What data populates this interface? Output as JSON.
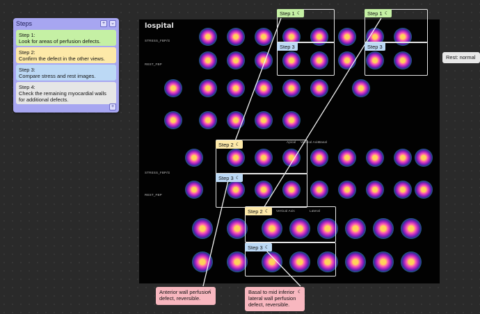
{
  "panel": {
    "title": "Steps",
    "add": "+",
    "collapse": "⌄",
    "steps": [
      {
        "label": "Step 1:",
        "text": "Look for areas of perfusion defects."
      },
      {
        "label": "Step 2:",
        "text": "Confirm the defect in the other views."
      },
      {
        "label": "Step 3:",
        "text": "Compare stress and rest images."
      },
      {
        "label": "Step 4:",
        "text": "Check the remaining myocardial walls for additional defects."
      }
    ],
    "footer_add": "+"
  },
  "viewer": {
    "brand": "lospital",
    "row_labels": [
      "STRESS_FBP/G",
      "REST_FBP",
      "STRESS_FBP/G",
      "REST_FBP"
    ],
    "mid_labels": [
      "Apical",
      "Vertical Axis",
      "Basal"
    ],
    "mid_labels2": [
      "Vertical Axis",
      "Lateral"
    ]
  },
  "tags": {
    "step1": "Step 1",
    "step2": "Step 2",
    "step3": "Step 3",
    "moon": "☾"
  },
  "notes": {
    "rest": "Rest: normal",
    "anterior": "Anterior wall perfusion defect, reversible.",
    "inferior": "Basal to mid inferior lateral wall perfusion defect, reversible."
  },
  "colors": {
    "panel": "#a7a6f1",
    "step1": "#c5f0a4",
    "step2": "#fde9a8",
    "step3": "#bcd9f5",
    "step4": "#e6e6e6",
    "note": "#f8b7bf"
  }
}
